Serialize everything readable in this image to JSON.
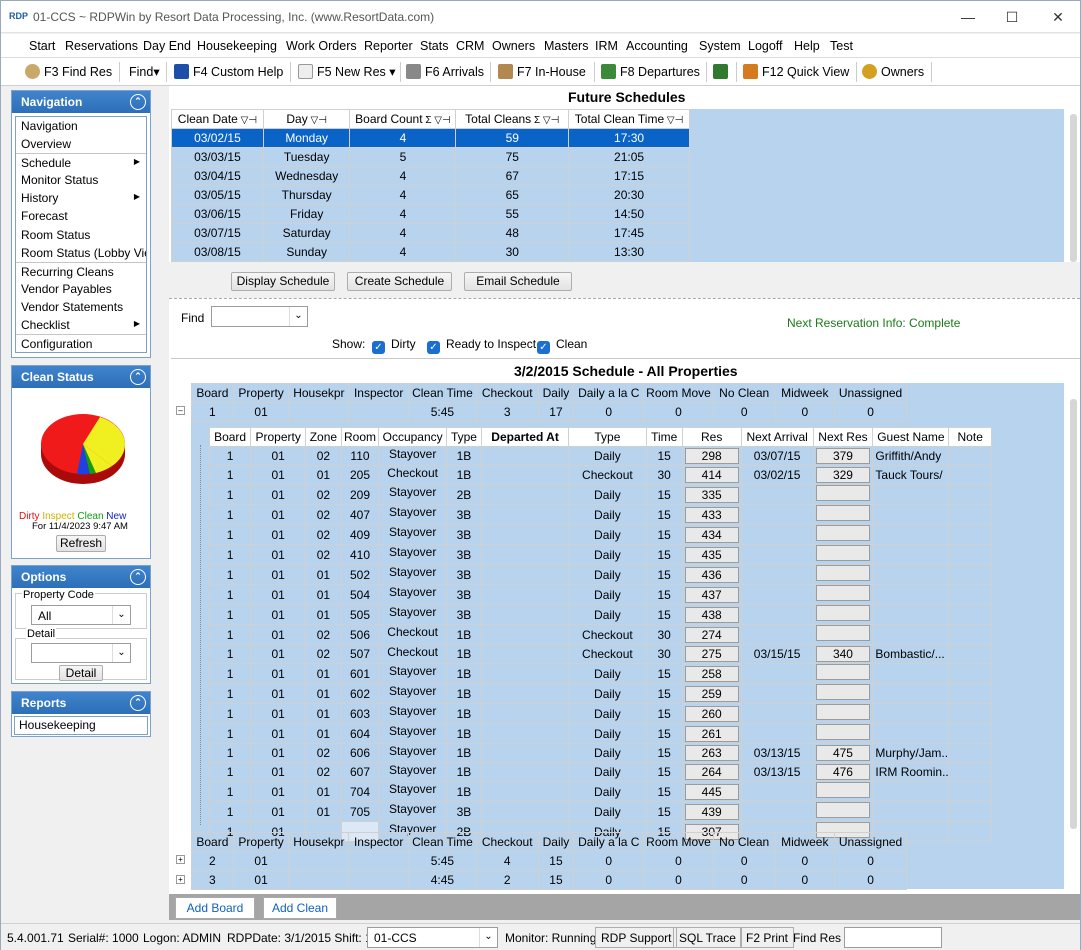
{
  "window": {
    "logo": "RDP",
    "title": "01-CCS ~ RDPWin by Resort Data Processing, Inc. (www.ResortData.com)"
  },
  "menu": [
    "Start",
    "Reservations",
    "Day End",
    "Housekeeping",
    "Work Orders",
    "Reporter",
    "Stats",
    "CRM",
    "Owners",
    "Masters",
    "IRM",
    "Accounting",
    "System",
    "Logoff",
    "Help",
    "Test"
  ],
  "toolbar": {
    "find_res": "F3 Find Res",
    "find": "Find",
    "custom_help": "F4 Custom Help",
    "new_res": "F5 New Res",
    "arrivals": "F6 Arrivals",
    "in_house": "F7 In-House",
    "departures": "F8 Departures",
    "quick_view": "F12 Quick View",
    "owners": "Owners"
  },
  "navigation": {
    "title": "Navigation",
    "items": [
      {
        "label": "Navigation",
        "arrow": false,
        "sep": false
      },
      {
        "label": "Overview",
        "arrow": false,
        "sep": false
      },
      {
        "label": "Schedule",
        "arrow": true,
        "sep": true
      },
      {
        "label": "Monitor Status",
        "arrow": false,
        "sep": false
      },
      {
        "label": "History",
        "arrow": true,
        "sep": false
      },
      {
        "label": "Forecast",
        "arrow": false,
        "sep": false
      },
      {
        "label": "Room Status",
        "arrow": false,
        "sep": false
      },
      {
        "label": "Room Status (Lobby Vie",
        "arrow": false,
        "sep": false
      },
      {
        "label": "Recurring Cleans",
        "arrow": false,
        "sep": true
      },
      {
        "label": "Vendor Payables",
        "arrow": false,
        "sep": false
      },
      {
        "label": "Vendor Statements",
        "arrow": false,
        "sep": false
      },
      {
        "label": "Checklist",
        "arrow": true,
        "sep": false
      },
      {
        "label": "Configuration",
        "arrow": false,
        "sep": true
      }
    ]
  },
  "clean_status": {
    "title": "Clean Status",
    "legend": [
      {
        "label": "Dirty",
        "color": "#e01010"
      },
      {
        "label": "Inspect",
        "color": "#e0c800"
      },
      {
        "label": "Clean",
        "color": "#10a010"
      },
      {
        "label": "New",
        "color": "#1020d0"
      }
    ],
    "date": "For 11/4/2023 9:47 AM",
    "refresh": "Refresh"
  },
  "options": {
    "title": "Options",
    "property_code_label": "Property Code",
    "property_code_value": "All",
    "detail_label": "Detail",
    "detail_value": "",
    "detail_button": "Detail"
  },
  "reports": {
    "title": "Reports",
    "item": "Housekeeping"
  },
  "future": {
    "title": "Future Schedules",
    "headers": [
      "Clean Date",
      "Day",
      "Board Count",
      "Total Cleans",
      "Total Clean Time"
    ],
    "rows": [
      [
        "03/02/15",
        "Monday",
        "4",
        "59",
        "17:30"
      ],
      [
        "03/03/15",
        "Tuesday",
        "5",
        "75",
        "21:05"
      ],
      [
        "03/04/15",
        "Wednesday",
        "4",
        "67",
        "17:15"
      ],
      [
        "03/05/15",
        "Thursday",
        "4",
        "65",
        "20:30"
      ],
      [
        "03/06/15",
        "Friday",
        "4",
        "55",
        "14:50"
      ],
      [
        "03/07/15",
        "Saturday",
        "4",
        "48",
        "17:45"
      ],
      [
        "03/08/15",
        "Sunday",
        "4",
        "30",
        "13:30"
      ]
    ],
    "buttons": {
      "display": "Display Schedule",
      "create": "Create Schedule",
      "email": "Email Schedule"
    }
  },
  "filter": {
    "find_label": "Find",
    "find_value": "",
    "show_label": "Show:",
    "dirty": "Dirty",
    "ready": "Ready to Inspect",
    "clean": "Clean",
    "next_res_info": "Next Reservation Info: Complete"
  },
  "schedule": {
    "title": "3/2/2015 Schedule - All Properties",
    "board_headers": [
      "Board",
      "Property",
      "Housekpr",
      "Inspector",
      "Clean Time",
      "Checkout",
      "Daily",
      "Daily a la C",
      "Room Move",
      "No Clean",
      "Midweek",
      "Unassigned"
    ],
    "board1": [
      "1",
      "01",
      "",
      "",
      "5:45",
      "3",
      "17",
      "0",
      "0",
      "0",
      "0",
      "0"
    ],
    "detail_headers": [
      "Board",
      "Property",
      "Zone",
      "Room",
      "Occupancy",
      "Type",
      "Departed At",
      "Type",
      "Time",
      "Res",
      "Next Arrival",
      "Next Res",
      "Guest Name",
      "Note"
    ],
    "detail_rows": [
      [
        "1",
        "01",
        "02",
        "110",
        "Stayover",
        "1B",
        "",
        "Daily",
        "15",
        "298",
        "03/07/15",
        "379",
        "Griffith/Andy",
        ""
      ],
      [
        "1",
        "01",
        "01",
        "205",
        "Checkout",
        "1B",
        "",
        "Checkout",
        "30",
        "414",
        "03/02/15",
        "329",
        "Tauck Tours/",
        ""
      ],
      [
        "1",
        "01",
        "02",
        "209",
        "Stayover",
        "2B",
        "",
        "Daily",
        "15",
        "335",
        "",
        "",
        "",
        ""
      ],
      [
        "1",
        "01",
        "02",
        "407",
        "Stayover",
        "3B",
        "",
        "Daily",
        "15",
        "433",
        "",
        "",
        "",
        ""
      ],
      [
        "1",
        "01",
        "02",
        "409",
        "Stayover",
        "3B",
        "",
        "Daily",
        "15",
        "434",
        "",
        "",
        "",
        ""
      ],
      [
        "1",
        "01",
        "02",
        "410",
        "Stayover",
        "3B",
        "",
        "Daily",
        "15",
        "435",
        "",
        "",
        "",
        ""
      ],
      [
        "1",
        "01",
        "01",
        "502",
        "Stayover",
        "3B",
        "",
        "Daily",
        "15",
        "436",
        "",
        "",
        "",
        ""
      ],
      [
        "1",
        "01",
        "01",
        "504",
        "Stayover",
        "3B",
        "",
        "Daily",
        "15",
        "437",
        "",
        "",
        "",
        ""
      ],
      [
        "1",
        "01",
        "01",
        "505",
        "Stayover",
        "3B",
        "",
        "Daily",
        "15",
        "438",
        "",
        "",
        "",
        ""
      ],
      [
        "1",
        "01",
        "02",
        "506",
        "Checkout",
        "1B",
        "",
        "Checkout",
        "30",
        "274",
        "",
        "",
        "",
        ""
      ],
      [
        "1",
        "01",
        "02",
        "507",
        "Checkout",
        "1B",
        "",
        "Checkout",
        "30",
        "275",
        "03/15/15",
        "340",
        "Bombastic/...",
        ""
      ],
      [
        "1",
        "01",
        "01",
        "601",
        "Stayover",
        "1B",
        "",
        "Daily",
        "15",
        "258",
        "",
        "",
        "",
        ""
      ],
      [
        "1",
        "01",
        "01",
        "602",
        "Stayover",
        "1B",
        "",
        "Daily",
        "15",
        "259",
        "",
        "",
        "",
        ""
      ],
      [
        "1",
        "01",
        "01",
        "603",
        "Stayover",
        "1B",
        "",
        "Daily",
        "15",
        "260",
        "",
        "",
        "",
        ""
      ],
      [
        "1",
        "01",
        "01",
        "604",
        "Stayover",
        "1B",
        "",
        "Daily",
        "15",
        "261",
        "",
        "",
        "",
        ""
      ],
      [
        "1",
        "01",
        "02",
        "606",
        "Stayover",
        "1B",
        "",
        "Daily",
        "15",
        "263",
        "03/13/15",
        "475",
        "Murphy/Jam...",
        ""
      ],
      [
        "1",
        "01",
        "02",
        "607",
        "Stayover",
        "1B",
        "",
        "Daily",
        "15",
        "264",
        "03/13/15",
        "476",
        "IRM Roomin...",
        ""
      ],
      [
        "1",
        "01",
        "01",
        "704",
        "Stayover",
        "1B",
        "",
        "Daily",
        "15",
        "445",
        "",
        "",
        "",
        ""
      ],
      [
        "1",
        "01",
        "01",
        "705",
        "Stayover",
        "3B",
        "",
        "Daily",
        "15",
        "439",
        "",
        "",
        "",
        ""
      ],
      [
        "1",
        "01",
        "",
        "",
        "Stayover",
        "2B",
        "",
        "Daily",
        "15",
        "307",
        "",
        "",
        "",
        ""
      ]
    ],
    "other_boards": [
      [
        "2",
        "01",
        "",
        "",
        "5:45",
        "4",
        "15",
        "0",
        "0",
        "0",
        "0",
        "0"
      ],
      [
        "3",
        "01",
        "",
        "",
        "4:45",
        "2",
        "15",
        "0",
        "0",
        "0",
        "0",
        "0"
      ]
    ]
  },
  "bottom": {
    "add_board": "Add Board",
    "add_clean": "Add Clean"
  },
  "status": {
    "version": "5.4.001.71",
    "serial": "Serial#: 1000",
    "logon": "Logon: ADMIN",
    "rdpdate": "RDPDate: 3/1/2015 Shift: 1",
    "property": "01-CCS",
    "monitor": "Monitor: Running",
    "support": "RDP Support",
    "sqltrace": "SQL Trace",
    "print": "F2 Print",
    "findres": "Find Res",
    "findres_value": ""
  }
}
